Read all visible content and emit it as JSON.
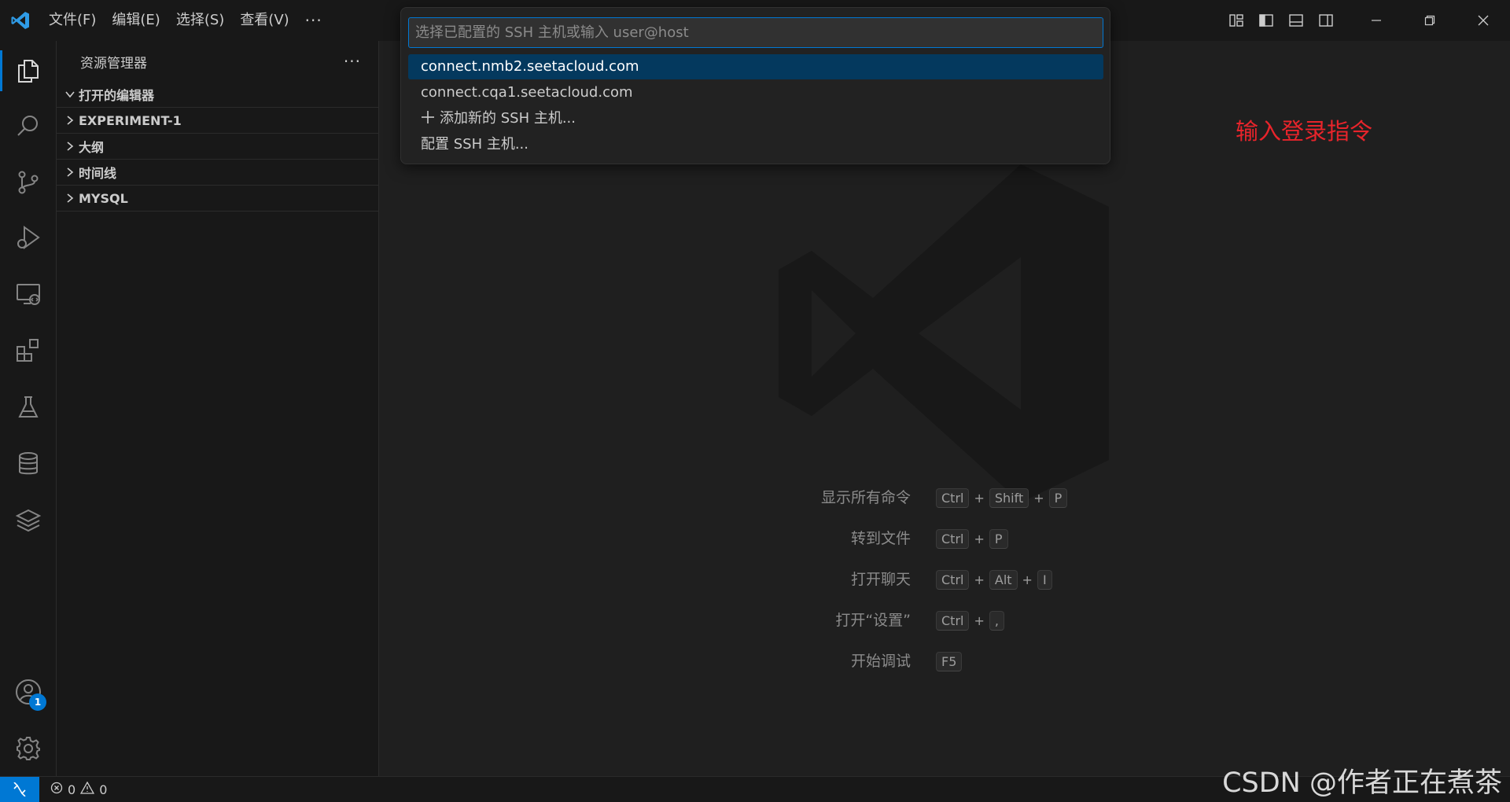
{
  "menu": {
    "items": [
      "文件(F)",
      "编辑(E)",
      "选择(S)",
      "查看(V)"
    ],
    "more": "···"
  },
  "activity": {
    "accounts_badge": "1"
  },
  "sidebar": {
    "title": "资源管理器",
    "more": "···",
    "sections": [
      "打开的编辑器",
      "EXPERIMENT-1",
      "大纲",
      "时间线",
      "MYSQL"
    ]
  },
  "quickpick": {
    "placeholder": "选择已配置的 SSH 主机或输入 user@host",
    "items": [
      "connect.nmb2.seetacloud.com",
      "connect.cqa1.seetacloud.com",
      "添加新的 SSH 主机...",
      "配置 SSH 主机..."
    ]
  },
  "annotation": "输入登录指令",
  "shortcuts": [
    {
      "label": "显示所有命令",
      "keys": [
        "Ctrl",
        "Shift",
        "P"
      ]
    },
    {
      "label": "转到文件",
      "keys": [
        "Ctrl",
        "P"
      ]
    },
    {
      "label": "打开聊天",
      "keys": [
        "Ctrl",
        "Alt",
        "I"
      ]
    },
    {
      "label": "打开“设置”",
      "keys": [
        "Ctrl",
        ","
      ]
    },
    {
      "label": "开始调试",
      "keys": [
        "F5"
      ]
    }
  ],
  "statusbar": {
    "errors": "0",
    "warnings": "0"
  },
  "watermark_text": "CSDN @作者正在煮茶",
  "colors": {
    "accent": "#0078d4",
    "selection": "#04395e",
    "annotation": "#e8242b",
    "background": "#1f1f1f",
    "chrome": "#181818"
  }
}
